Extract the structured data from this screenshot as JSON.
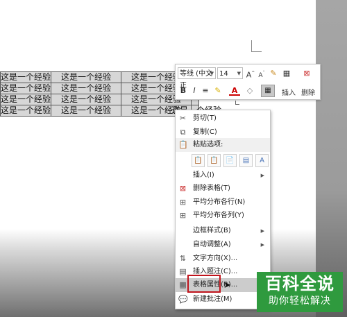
{
  "table": {
    "rows": [
      [
        "这是一个经验",
        "这是一个经验",
        "这是一个经验",
        ""
      ],
      [
        "这是一个经验",
        "这是一个经验",
        "这是一个经验",
        ""
      ],
      [
        "这是一个经验",
        "这是一个经验",
        "这是一个经验",
        ""
      ],
      [
        "这是一个经验",
        "这是一个经验",
        "这是一个经验",
        ""
      ]
    ],
    "last_cell": "这是一个经验"
  },
  "mini_toolbar": {
    "font_name": "等线 (中文正",
    "font_size": "14",
    "bold": "B",
    "italic": "I",
    "font_color_letter": "A",
    "insert_label": "插入",
    "delete_label": "删除"
  },
  "context_menu": {
    "items": [
      {
        "label": "剪切(T)",
        "icon": "scissors-icon"
      },
      {
        "label": "复制(C)",
        "icon": "copy-icon"
      },
      {
        "label": "粘贴选项:",
        "icon": "paste-icon"
      },
      {
        "label": "插入(I)",
        "icon": "",
        "has_submenu": true
      },
      {
        "label": "删除表格(T)",
        "icon": "delete-table-icon"
      },
      {
        "label": "平均分布各行(N)",
        "icon": "distribute-rows-icon"
      },
      {
        "label": "平均分布各列(Y)",
        "icon": "distribute-columns-icon"
      },
      {
        "label": "边框样式(B)",
        "icon": "",
        "has_submenu": true
      },
      {
        "label": "自动调整(A)",
        "icon": "",
        "has_submenu": true
      },
      {
        "label": "文字方向(X)...",
        "icon": "text-direction-icon"
      },
      {
        "label": "插入题注(C)...",
        "icon": "caption-icon"
      },
      {
        "label": "表格属性(R)...",
        "icon": "table-properties-icon"
      },
      {
        "label": "新建批注(M)",
        "icon": "new-comment-icon"
      }
    ],
    "paste_options": [
      "keep-source-icon",
      "merge-table-icon",
      "nest-table-icon",
      "new-rows-icon",
      "text-only-icon"
    ]
  },
  "watermark": {
    "title": "百科全说",
    "subtitle": "助你轻松解决",
    "color": "#2f9a3e"
  },
  "highlight_color": "#c0141c"
}
